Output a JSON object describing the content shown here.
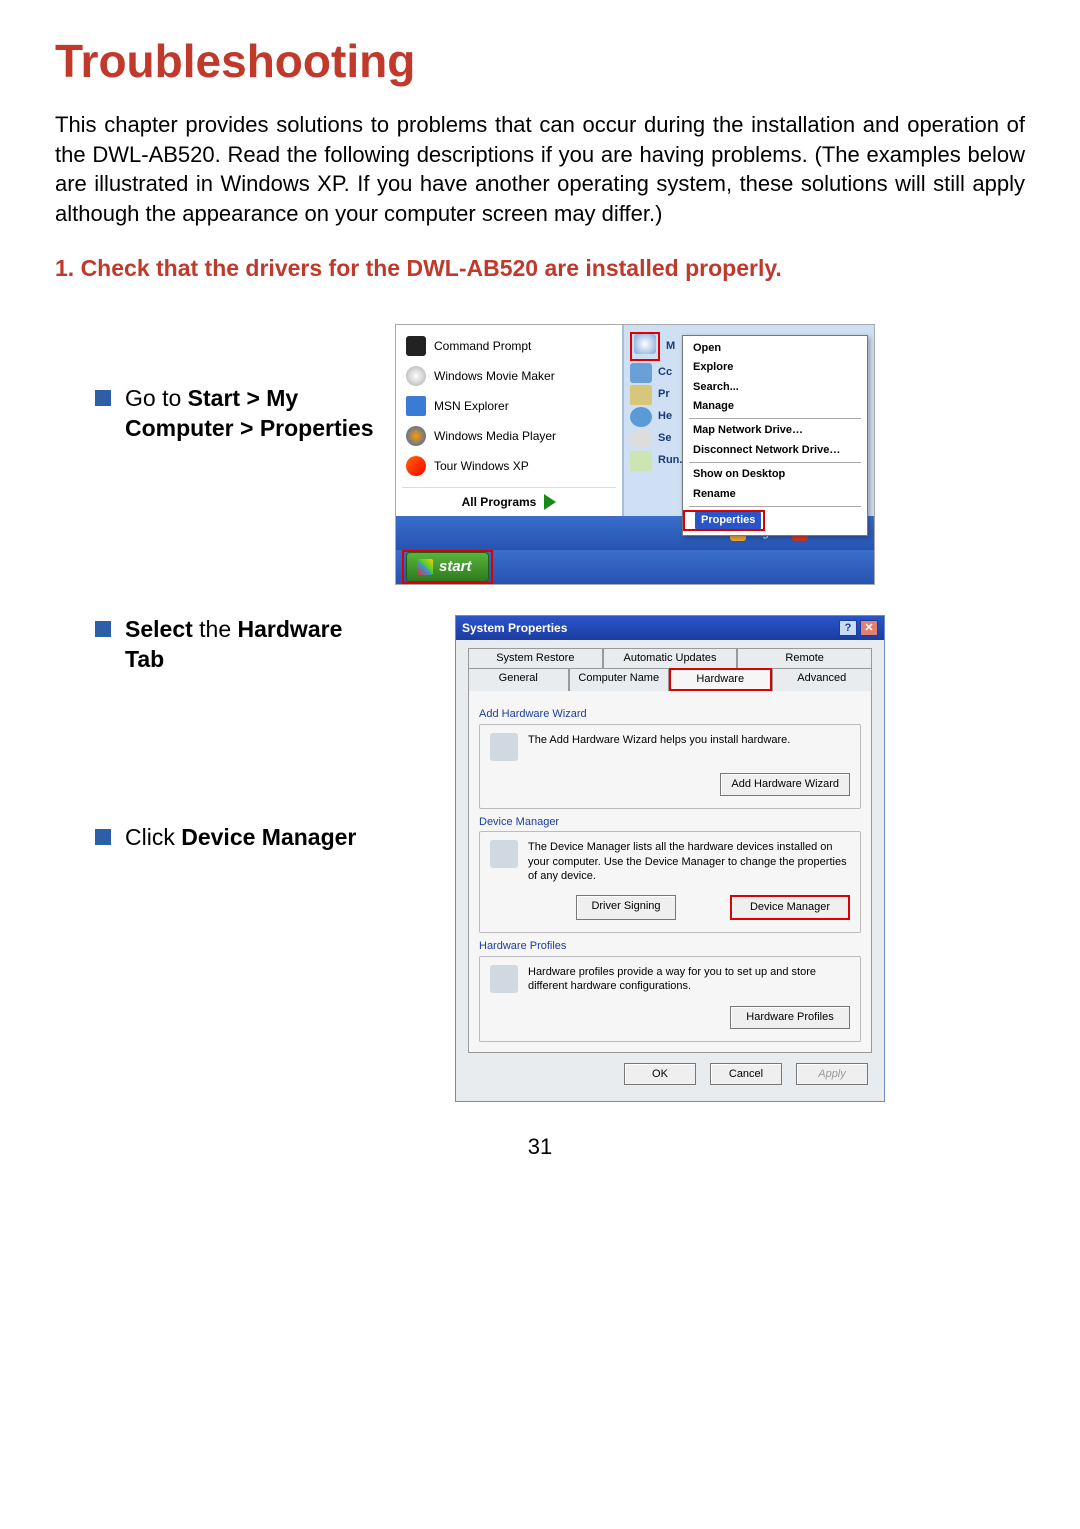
{
  "title": "Troubleshooting",
  "intro": "This chapter provides solutions to problems that can occur during the installation and operation of the DWL-AB520.  Read the following descriptions if you are having problems.  (The examples below are illustrated in Windows XP.  If you have another operating system, these solutions will still apply although the appearance on your computer screen may differ.)",
  "step1_heading": "1.  Check that the drivers for the DWL-AB520 are  installed properly.",
  "bullets": {
    "b1_pre": "Go to ",
    "b1_bold": "Start > My Computer > Properties",
    "b2_bold1": "Select",
    "b2_mid": " the ",
    "b2_bold2": "Hardware Tab",
    "b3_pre": "Click ",
    "b3_bold": "Device Manager"
  },
  "startmenu": {
    "left": {
      "cmd": "Command Prompt",
      "wmm": "Windows Movie Maker",
      "msn": "MSN Explorer",
      "wmp": "Windows Media Player",
      "twx": "Tour Windows XP",
      "allp": "All Programs"
    },
    "right": {
      "me": "M",
      "cc": "Cc",
      "pr": "Pr",
      "he": "He",
      "se": "Se",
      "run": "Run..."
    },
    "context": {
      "open": "Open",
      "explore": "Explore",
      "search": "Search...",
      "manage": "Manage",
      "mapnet": "Map Network Drive…",
      "disnet": "Disconnect Network Drive…",
      "showdesk": "Show on Desktop",
      "rename": "Rename",
      "properties": "Properties"
    },
    "footer": {
      "logoff": "Log Off",
      "shutdown": "Shut Down"
    },
    "start": "start"
  },
  "sysprops": {
    "title": "System Properties",
    "tabs": {
      "sysrestore": "System Restore",
      "autoupd": "Automatic Updates",
      "remote": "Remote",
      "general": "General",
      "compname": "Computer Name",
      "hardware": "Hardware",
      "advanced": "Advanced"
    },
    "grp1": {
      "title": "Add Hardware Wizard",
      "text": "The Add Hardware Wizard helps you install hardware.",
      "btn": "Add Hardware Wizard"
    },
    "grp2": {
      "title": "Device Manager",
      "text": "The Device Manager lists all the hardware devices installed on your computer. Use the Device Manager to change the properties of any device.",
      "btn_sign": "Driver Signing",
      "btn_devmgr": "Device Manager"
    },
    "grp3": {
      "title": "Hardware Profiles",
      "text": "Hardware profiles provide a way for you to set up and store different hardware configurations.",
      "btn": "Hardware Profiles"
    },
    "dlg": {
      "ok": "OK",
      "cancel": "Cancel",
      "apply": "Apply"
    }
  },
  "page_number": "31"
}
